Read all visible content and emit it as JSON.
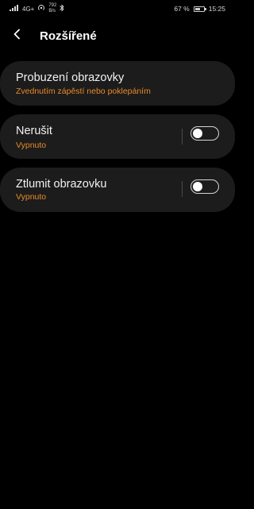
{
  "status_bar": {
    "signal_text": "4G+",
    "speed_value": "792",
    "speed_unit": "B/s",
    "battery_percent": "67 %",
    "battery_level": 0.67,
    "time": "15:25"
  },
  "header": {
    "title": "Rozšířené"
  },
  "settings": [
    {
      "title": "Probuzení obrazovky",
      "subtitle": "Zvednutím zápěstí nebo poklepáním",
      "has_toggle": false
    },
    {
      "title": "Nerušit",
      "subtitle": "Vypnuto",
      "has_toggle": true,
      "toggle_on": false
    },
    {
      "title": "Ztlumit obrazovku",
      "subtitle": "Vypnuto",
      "has_toggle": true,
      "toggle_on": false
    }
  ],
  "colors": {
    "background": "#000000",
    "card": "#1c1c1c",
    "accent": "#e98a2b"
  }
}
